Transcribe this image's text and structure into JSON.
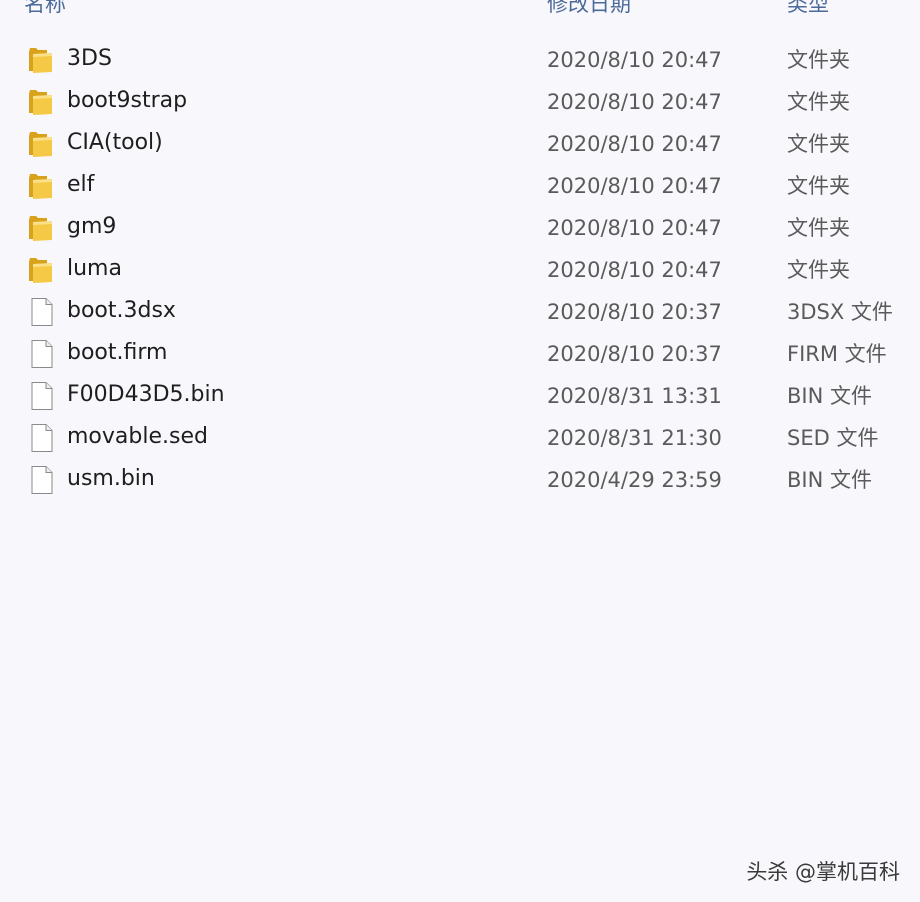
{
  "header": {
    "name_label": "名称",
    "date_label": "修改日期",
    "type_label": "类型"
  },
  "files": [
    {
      "name": "3DS",
      "date": "2020/8/10 20:47",
      "type": "文件夹",
      "icon": "folder-icon"
    },
    {
      "name": "boot9strap",
      "date": "2020/8/10 20:47",
      "type": "文件夹",
      "icon": "folder-icon"
    },
    {
      "name": "CIA(tool)",
      "date": "2020/8/10 20:47",
      "type": "文件夹",
      "icon": "folder-icon"
    },
    {
      "name": "elf",
      "date": "2020/8/10 20:47",
      "type": "文件夹",
      "icon": "folder-icon"
    },
    {
      "name": "gm9",
      "date": "2020/8/10 20:47",
      "type": "文件夹",
      "icon": "folder-icon"
    },
    {
      "name": "luma",
      "date": "2020/8/10 20:47",
      "type": "文件夹",
      "icon": "folder-icon"
    },
    {
      "name": "boot.3dsx",
      "date": "2020/8/10 20:37",
      "type": "3DSX 文件",
      "icon": "file-icon"
    },
    {
      "name": "boot.firm",
      "date": "2020/8/10 20:37",
      "type": "FIRM 文件",
      "icon": "file-icon"
    },
    {
      "name": "F00D43D5.bin",
      "date": "2020/8/31 13:31",
      "type": "BIN 文件",
      "icon": "file-icon"
    },
    {
      "name": "movable.sed",
      "date": "2020/8/31 21:30",
      "type": "SED 文件",
      "icon": "file-icon"
    },
    {
      "name": "usm.bin",
      "date": "2020/4/29 23:59",
      "type": "BIN 文件",
      "icon": "file-icon"
    }
  ],
  "watermark": "头杀 @掌机百科",
  "colors": {
    "background": "#f8f7fb",
    "folder": "#f2c23e",
    "header_text": "#4a6a9a"
  }
}
